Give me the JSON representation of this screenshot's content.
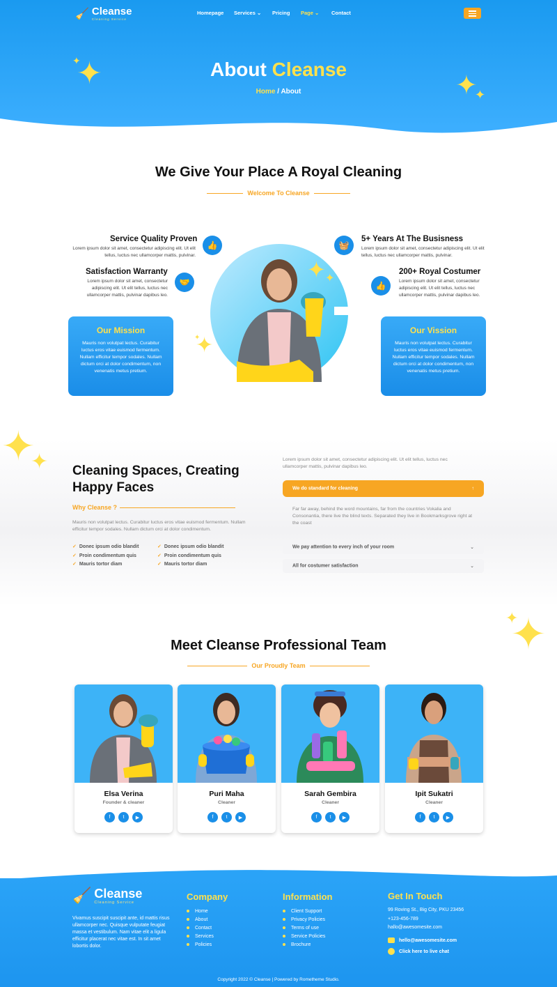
{
  "header": {
    "logo": {
      "name": "Cleanse",
      "tagline": "Cleaning Service"
    },
    "nav": [
      {
        "label": "Homepage",
        "active": false,
        "dropdown": false
      },
      {
        "label": "Services",
        "active": false,
        "dropdown": true
      },
      {
        "label": "Pricing",
        "active": false,
        "dropdown": false
      },
      {
        "label": "Page",
        "active": true,
        "dropdown": true
      },
      {
        "label": "Contact",
        "active": false,
        "dropdown": false
      }
    ]
  },
  "hero": {
    "title_a": "About",
    "title_b": "Cleanse",
    "crumb_home": "Home",
    "crumb_sep": "/",
    "crumb_current": "About"
  },
  "royal": {
    "heading": "We Give Your Place A Royal Cleaning",
    "sub": "Welcome To Cleanse",
    "features": [
      {
        "title": "Service Quality Proven",
        "text": "Lorem ipsum dolor sit amet, consectetur adipiscing elit. Ut elit tellus, luctus nec ullamcorper mattis, pulvinar.",
        "icon": "thumbs-up-icon"
      },
      {
        "title": "Satisfaction Warranty",
        "text": "Lorem ipsum dolor sit amet, consectetur adipiscing elit. Ut elit tellus, luctus nec ullamcorper mattis, pulvinar dapibus leo.",
        "icon": "handshake-icon"
      },
      {
        "title": "5+ Years At The Busisness",
        "text": "Lorem ipsum dolor sit amet, consectetur adipiscing elit. Ut elit tellus, luctus nec ullamcorper mattis, pulvinar.",
        "icon": "cleaning-cart-icon"
      },
      {
        "title": "200+ Royal Costumer",
        "text": "Lorem ipsum dolor sit amet, consectetur adipiscing elit. Ut elit tellus, luctus nec ullamcorper mattis, pulvinar dapibus leo.",
        "icon": "thumbs-up-icon"
      }
    ],
    "mission": {
      "title": "Our Mission",
      "text": "Mauris non volutpat lectus. Curabitur luctus eros vitae euismod fermentum. Nullam efficitur tempor sodales. Nullam dictum orci at dolor condimentum, non venenatis metus pretium."
    },
    "vision": {
      "title": "Our Vission",
      "text": "Mauris non volutpat lectus. Curabitur luctus eros vitae euismod fermentum. Nullam efficitur tempor sodales. Nullam dictum orci at dolor condimentum, non venenatis metus pretium."
    }
  },
  "why": {
    "heading_line1": "Cleaning Spaces, Creating",
    "heading_line2": "Happy Faces",
    "label": "Why Cleanse ?",
    "text": "Mauris non volutpat lectus. Curabitur luctus eros vitae euismod fermentum. Nullam efficitur tempor sodales. Nullam dictum orci at dolor condimentum.",
    "checks_left": [
      "Donec ipsum odio blandit",
      "Proin condimentum quis",
      "Mauris tortor diam"
    ],
    "checks_right": [
      "Donec ipsum odio blandit",
      "Proin condimentum quis",
      "Mauris tortor diam"
    ],
    "intro": "Lorem ipsum dolor sit amet, consectetur adipiscing elit. Ut elit tellus, luctus nec ullamcorper mattis, pulvinar dapibus leo.",
    "accordion": [
      {
        "title": "We do standard for cleaning",
        "open": true,
        "body": "Far far away, behind the word mountains, far from the countries Vokalia and Consonantia, there live the blind texts. Separated they live in Bookmarksgrove right at the coast"
      },
      {
        "title": "We pay attention to every inch of your room",
        "open": false
      },
      {
        "title": "All for costumer satisfaction",
        "open": false
      }
    ]
  },
  "team": {
    "heading": "Meet Cleanse Professional Team",
    "sub": "Our Proudly Team",
    "members": [
      {
        "name": "Elsa Verina",
        "role": "Founder & cleaner"
      },
      {
        "name": "Puri Maha",
        "role": "Cleaner"
      },
      {
        "name": "Sarah Gembira",
        "role": "Cleaner"
      },
      {
        "name": "Ipit Sukatri",
        "role": "Cleaner"
      }
    ]
  },
  "footer": {
    "about": "Vivamus suscipit suscipit ante, id mattis risus ullamcorper nec. Quisque vulputate feugiat massa et vestibulum. Nam vitae elit a ligula efficitur placerat nec vitae est. In sit amet lobortis dolor.",
    "company_title": "Company",
    "company": [
      "Home",
      "About",
      "Contact",
      "Services",
      "Policies"
    ],
    "info_title": "Information",
    "info": [
      "Client Support",
      "Privacy Policies",
      "Terms of use",
      "Service Policies",
      "Brochure"
    ],
    "contact_title": "Get In Touch",
    "address": "99 Roving St., Big City, PKU 23456",
    "phone": "+123-456-789",
    "email_plain": "hallo@awesomesite.com",
    "email_bold": "hello@awesomesite.com",
    "chat": "Click here to live chat",
    "copyright": "Copyright 2022 © Cleanse | Powered by Rometheme Studio."
  },
  "colors": {
    "primary": "#1a9af0",
    "accent": "#f7a623",
    "highlight": "#ffe14d"
  }
}
